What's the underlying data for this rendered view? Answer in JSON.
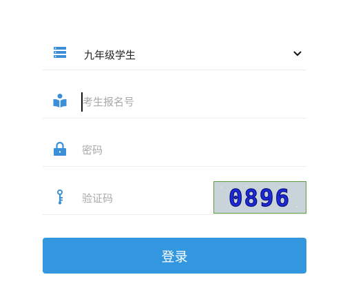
{
  "grade_select": {
    "value": "九年级学生",
    "icon": "list-icon"
  },
  "username": {
    "placeholder": "考生报名号",
    "value": "",
    "icon": "reader-icon"
  },
  "password": {
    "placeholder": "密码",
    "value": "",
    "icon": "lock-icon"
  },
  "captcha": {
    "placeholder": "验证码",
    "value": "",
    "icon": "key-icon",
    "image_text": "0896"
  },
  "login_button": {
    "label": "登录"
  },
  "colors": {
    "accent": "#3397e0",
    "icon": "#3a8fd6",
    "captcha_text": "#1c2ad8"
  }
}
